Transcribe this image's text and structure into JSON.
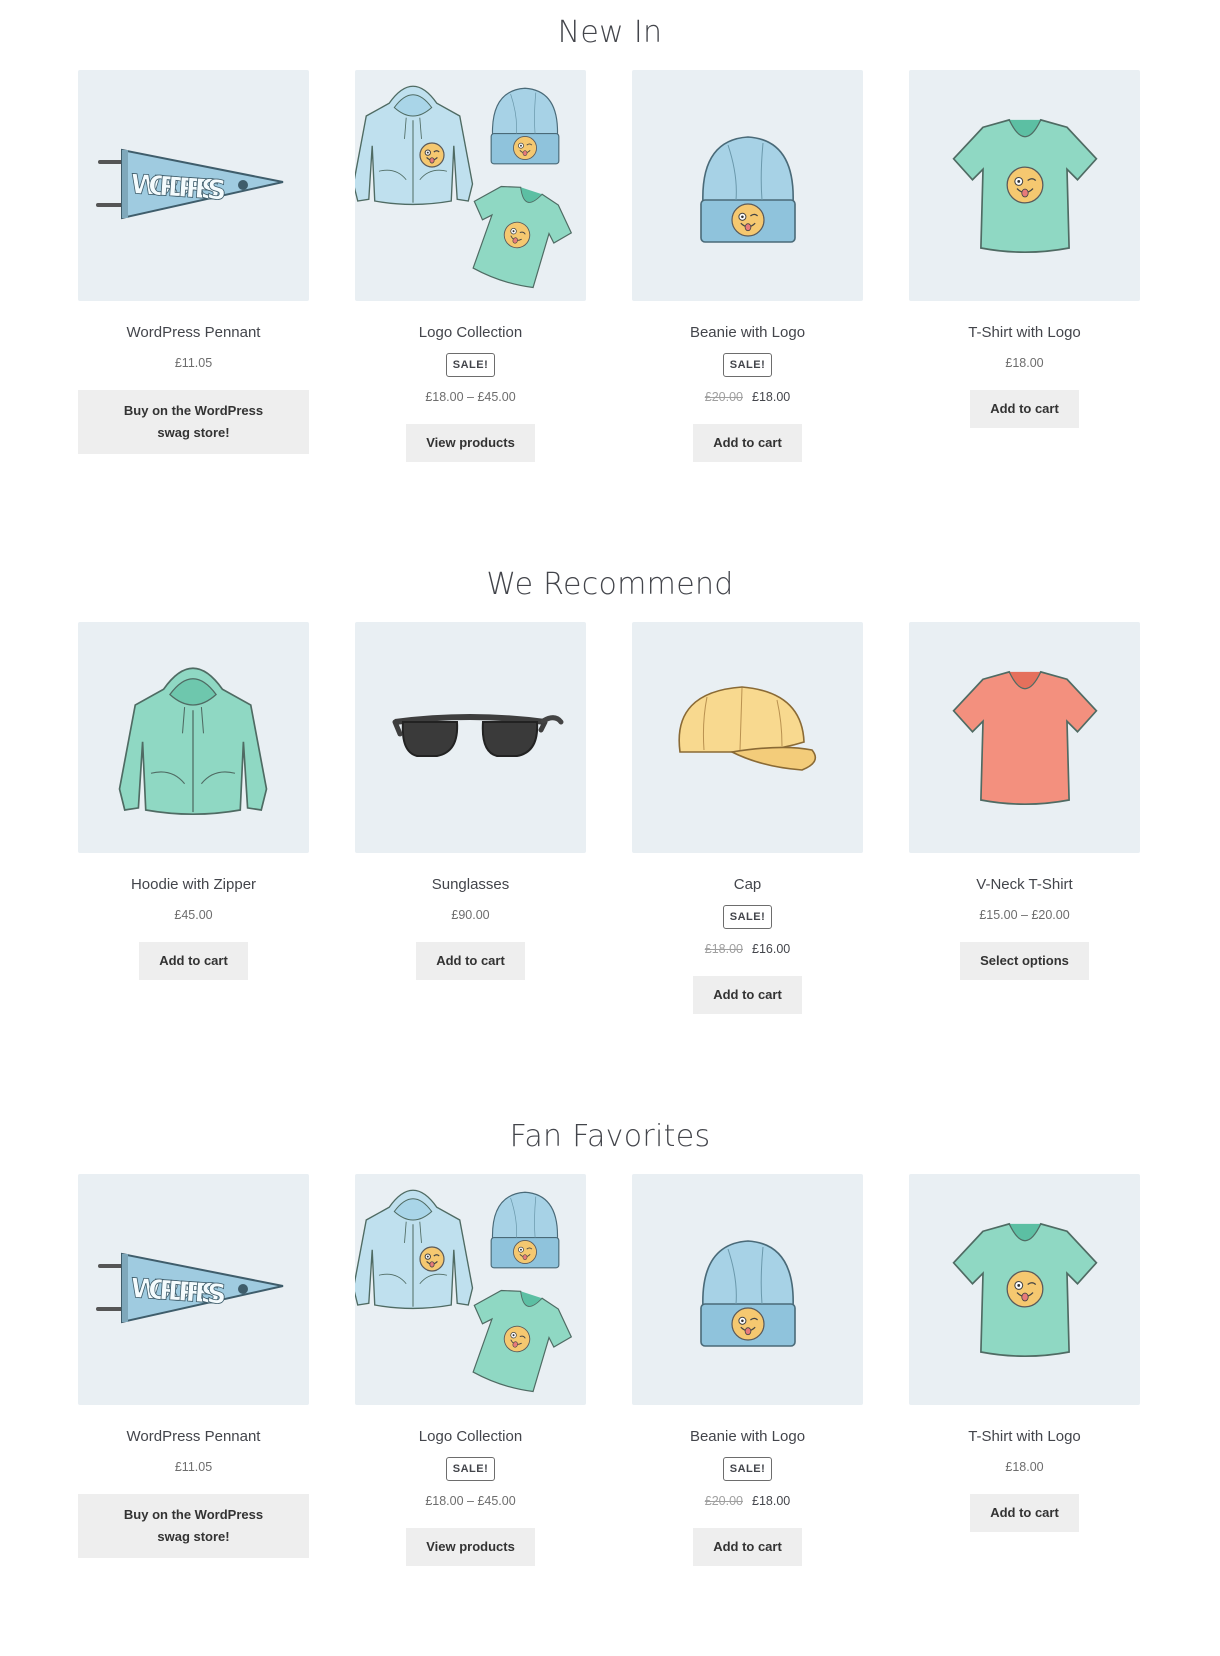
{
  "sections": [
    {
      "title": "New In",
      "products": [
        {
          "name": "WordPress Pennant",
          "badge": "",
          "old_price": "",
          "price": "£11.05",
          "button": "Buy on the WordPress swag store!",
          "image": "pennant-image"
        },
        {
          "name": "Logo Collection",
          "badge": "SALE!",
          "old_price": "",
          "price": "£18.00 – £45.00",
          "button": "View products",
          "image": "logo-collection-image"
        },
        {
          "name": "Beanie with Logo",
          "badge": "SALE!",
          "old_price": "£20.00",
          "price": "£18.00",
          "button": "Add to cart",
          "image": "beanie-image"
        },
        {
          "name": "T-Shirt with Logo",
          "badge": "",
          "old_price": "",
          "price": "£18.00",
          "button": "Add to cart",
          "image": "tshirt-logo-image"
        }
      ]
    },
    {
      "title": "We Recommend",
      "products": [
        {
          "name": "Hoodie with Zipper",
          "badge": "",
          "old_price": "",
          "price": "£45.00",
          "button": "Add to cart",
          "image": "hoodie-zipper-image"
        },
        {
          "name": "Sunglasses",
          "badge": "",
          "old_price": "",
          "price": "£90.00",
          "button": "Add to cart",
          "image": "sunglasses-image"
        },
        {
          "name": "Cap",
          "badge": "SALE!",
          "old_price": "£18.00",
          "price": "£16.00",
          "button": "Add to cart",
          "image": "cap-image"
        },
        {
          "name": "V-Neck T-Shirt",
          "badge": "",
          "old_price": "",
          "price": "£15.00 – £20.00",
          "button": "Select options",
          "image": "vneck-image"
        }
      ]
    },
    {
      "title": "Fan Favorites",
      "products": [
        {
          "name": "WordPress Pennant",
          "badge": "",
          "old_price": "",
          "price": "£11.05",
          "button": "Buy on the WordPress swag store!",
          "image": "pennant-image"
        },
        {
          "name": "Logo Collection",
          "badge": "SALE!",
          "old_price": "",
          "price": "£18.00 – £45.00",
          "button": "View products",
          "image": "logo-collection-image"
        },
        {
          "name": "Beanie with Logo",
          "badge": "SALE!",
          "old_price": "£20.00",
          "price": "£18.00",
          "button": "Add to cart",
          "image": "beanie-image"
        },
        {
          "name": "T-Shirt with Logo",
          "badge": "",
          "old_price": "",
          "price": "£18.00",
          "button": "Add to cart",
          "image": "tshirt-logo-image"
        }
      ]
    }
  ],
  "pennant_text": "WORDPRESS",
  "colors": {
    "thumb_bg": "#e9eff3",
    "button_bg": "#eeeeee",
    "text": "#43454b",
    "mint": "#8fd8c3",
    "sky": "#9fcbe0",
    "coral": "#f3907e",
    "sand": "#f5d48f"
  }
}
